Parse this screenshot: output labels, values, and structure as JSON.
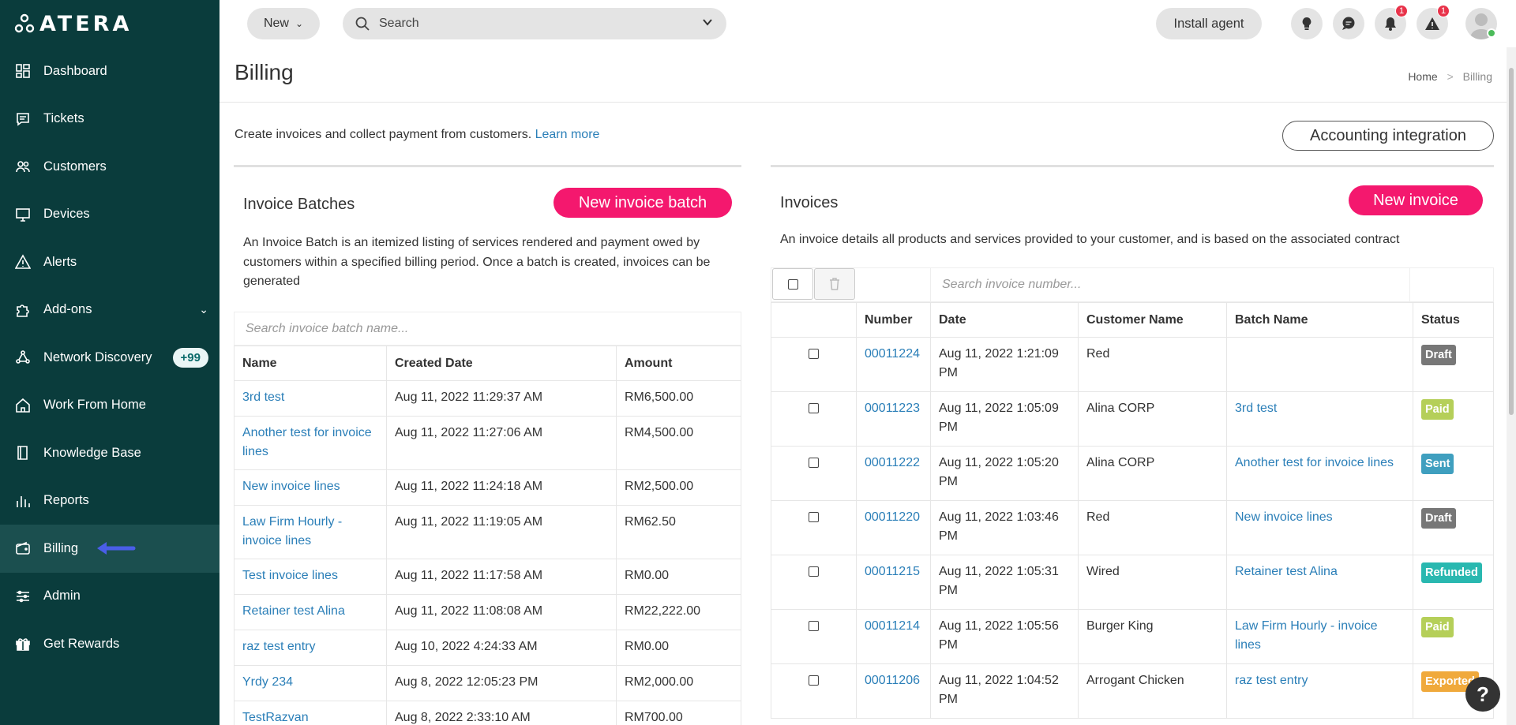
{
  "sidebar": {
    "logo_text": "ATERA",
    "items": [
      {
        "label": "Dashboard"
      },
      {
        "label": "Tickets"
      },
      {
        "label": "Customers"
      },
      {
        "label": "Devices"
      },
      {
        "label": "Alerts"
      },
      {
        "label": "Add-ons"
      },
      {
        "label": "Network Discovery",
        "badge": "+99"
      },
      {
        "label": "Work From Home"
      },
      {
        "label": "Knowledge Base"
      },
      {
        "label": "Reports"
      },
      {
        "label": "Billing"
      },
      {
        "label": "Admin"
      },
      {
        "label": "Get Rewards"
      }
    ]
  },
  "topbar": {
    "new_label": "New",
    "search_label": "Search",
    "install_label": "Install agent",
    "notifications_count": "1",
    "alerts_count": "1"
  },
  "page": {
    "title": "Billing",
    "breadcrumb_home": "Home",
    "breadcrumb_sep": ">",
    "breadcrumb_current": "Billing",
    "intro_text": "Create invoices and collect payment from customers.",
    "learn_more": "Learn more",
    "accounting_btn": "Accounting integration"
  },
  "batches": {
    "title": "Invoice Batches",
    "new_btn": "New invoice batch",
    "description": "An Invoice Batch is an itemized listing of services rendered and payment owed by customers within a specified billing period. Once a batch is created, invoices can be generated",
    "search_placeholder": "Search invoice batch name...",
    "columns": [
      "Name",
      "Created Date",
      "Amount"
    ],
    "rows": [
      {
        "name": "3rd test",
        "date": "Aug 11, 2022 11:29:37 AM",
        "amount": "RM6,500.00"
      },
      {
        "name": "Another test for invoice lines",
        "date": "Aug 11, 2022 11:27:06 AM",
        "amount": "RM4,500.00"
      },
      {
        "name": "New invoice lines",
        "date": "Aug 11, 2022 11:24:18 AM",
        "amount": "RM2,500.00"
      },
      {
        "name": "Law Firm Hourly - invoice lines",
        "date": "Aug 11, 2022 11:19:05 AM",
        "amount": "RM62.50"
      },
      {
        "name": "Test invoice lines",
        "date": "Aug 11, 2022 11:17:58 AM",
        "amount": "RM0.00"
      },
      {
        "name": "Retainer test Alina",
        "date": "Aug 11, 2022 11:08:08 AM",
        "amount": "RM22,222.00"
      },
      {
        "name": "raz test entry",
        "date": "Aug 10, 2022 4:24:33 AM",
        "amount": "RM0.00"
      },
      {
        "name": "Yrdy 234",
        "date": "Aug 8, 2022 12:05:23 PM",
        "amount": "RM2,000.00"
      },
      {
        "name": "TestRazvan",
        "date": "Aug 8, 2022 2:33:10 AM",
        "amount": "RM700.00"
      }
    ]
  },
  "invoices": {
    "title": "Invoices",
    "new_btn": "New invoice",
    "description": "An invoice details all products and services provided to your customer, and is based on the associated contract",
    "search_placeholder": "Search invoice number...",
    "columns": [
      "",
      "Number",
      "Date",
      "Customer Name",
      "Batch Name",
      "Status"
    ],
    "rows": [
      {
        "number": "00011224",
        "date": "Aug 11, 2022 1:21:09 PM",
        "customer": "Red",
        "batch": "",
        "status": "Draft",
        "status_color": "#777777"
      },
      {
        "number": "00011223",
        "date": "Aug 11, 2022 1:05:09 PM",
        "customer": "Alina CORP",
        "batch": "3rd test",
        "status": "Paid",
        "status_color": "#b5cf59"
      },
      {
        "number": "00011222",
        "date": "Aug 11, 2022 1:05:20 PM",
        "customer": "Alina CORP",
        "batch": "Another test for invoice lines",
        "status": "Sent",
        "status_color": "#3f9fbf"
      },
      {
        "number": "00011220",
        "date": "Aug 11, 2022 1:03:46 PM",
        "customer": "Red",
        "batch": "New invoice lines",
        "status": "Draft",
        "status_color": "#777777"
      },
      {
        "number": "00011215",
        "date": "Aug 11, 2022 1:05:31 PM",
        "customer": "Wired",
        "batch": "Retainer test Alina",
        "status": "Refunded",
        "status_color": "#29b8b0"
      },
      {
        "number": "00011214",
        "date": "Aug 11, 2022 1:05:56 PM",
        "customer": "Burger King",
        "batch": "Law Firm Hourly - invoice lines",
        "status": "Paid",
        "status_color": "#b5cf59"
      },
      {
        "number": "00011206",
        "date": "Aug 11, 2022 1:04:52 PM",
        "customer": "Arrogant Chicken",
        "batch": "raz test entry",
        "status": "Exported",
        "status_color": "#f0a93b"
      }
    ]
  },
  "help_label": "?"
}
